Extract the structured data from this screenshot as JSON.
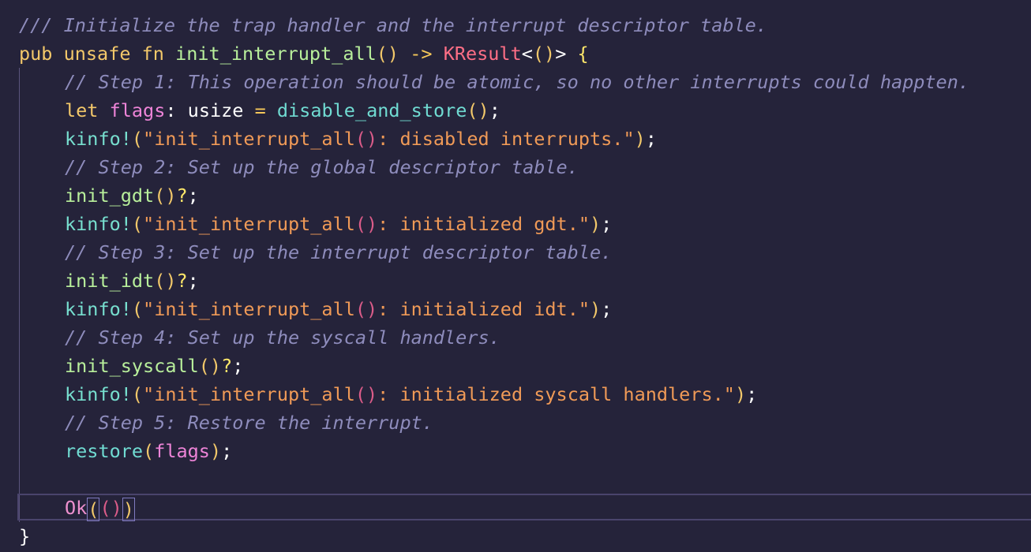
{
  "code": {
    "doc_comment": "/// Initialize the trap handler and the interrupt descriptor table.",
    "kw_pub": "pub",
    "kw_unsafe": "unsafe",
    "kw_fn": "fn",
    "fn_name": "init_interrupt_all",
    "fn_parens": "()",
    "arrow": "->",
    "return_type": "KResult",
    "generic_open": "<",
    "unit": "()",
    "generic_close": ">",
    "open_brace": "{",
    "step1_comment": "// Step 1: This operation should be atomic, so no other interrupts could happten.",
    "kw_let": "let",
    "var_flags": "flags",
    "colon": ":",
    "type_usize": "usize",
    "equals": "=",
    "disable_call": "disable_and_store",
    "semicolon": ";",
    "kinfo_macro": "kinfo!",
    "paren_open": "(",
    "paren_close": ")",
    "quote": "\"",
    "log_prefix": "init_interrupt_all",
    "empty_parens": "()",
    "msg_disabled": ": disabled interrupts.",
    "step2_comment": "// Step 2: Set up the global descriptor table.",
    "init_gdt": "init_gdt",
    "question": "?",
    "msg_gdt": ": initialized gdt.",
    "step3_comment": "// Step 3: Set up the interrupt descriptor table.",
    "init_idt": "init_idt",
    "msg_idt": ": initialized idt.",
    "step4_comment": "// Step 4: Set up the syscall handlers.",
    "init_syscall": "init_syscall",
    "msg_syscall": ": initialized syscall handlers.",
    "step5_comment": "// Step 5: Restore the interrupt.",
    "restore_call": "restore",
    "ok_ctor": "Ok",
    "close_brace": "}"
  },
  "colors": {
    "background": "#25233a",
    "comment": "#8e8cbc",
    "keyword": "#f3c86a",
    "function": "#b8ef9b",
    "call": "#70dbd2",
    "string": "#f09a57",
    "return_type": "#ff6f86"
  }
}
